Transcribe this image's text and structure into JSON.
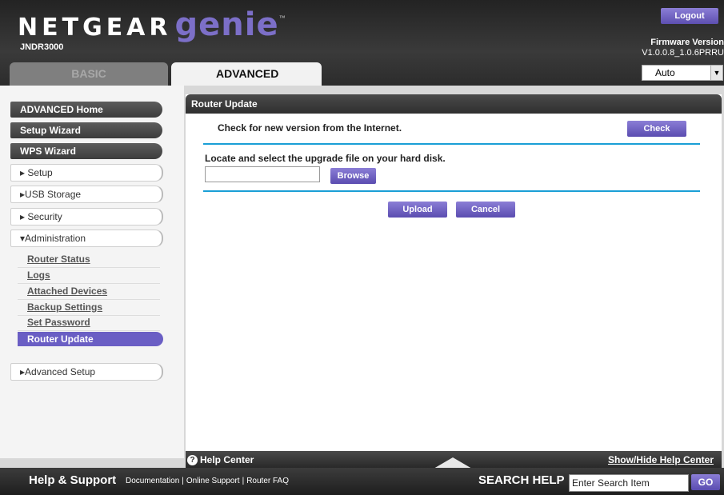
{
  "header": {
    "brand": "NETGEAR",
    "product": "genie",
    "trademark": "™",
    "model": "JNDR3000",
    "logout_label": "Logout",
    "firmware_label": "Firmware Version",
    "firmware_value": "V1.0.0.8_1.0.6PRRU",
    "tabs": {
      "basic": "BASIC",
      "advanced": "ADVANCED"
    },
    "selector_value": "Auto"
  },
  "sidebar": {
    "advanced_home": "ADVANCED Home",
    "setup_wizard": "Setup Wizard",
    "wps_wizard": "WPS Wizard",
    "setup": "▸ Setup",
    "usb_storage": "▸USB Storage",
    "security": "▸ Security",
    "administration": "▾Administration",
    "admin_items": [
      "Router Status",
      "Logs",
      "Attached Devices",
      "Backup Settings",
      "Set Password"
    ],
    "active_item": "Router Update",
    "advanced_setup": "▸Advanced Setup"
  },
  "main": {
    "title": "Router Update",
    "check_text": "Check for new version from the Internet.",
    "check_button": "Check",
    "locate_text": "Locate and select the upgrade file on your hard disk.",
    "browse_button": "Browse",
    "upload_button": "Upload",
    "cancel_button": "Cancel"
  },
  "helpbar": {
    "help_center": "Help Center",
    "toggle_label": "Show/Hide Help Center"
  },
  "footer": {
    "title": "Help & Support",
    "links": [
      "Documentation",
      "Online Support",
      "Router FAQ"
    ],
    "search_label": "SEARCH HELP",
    "search_value": "Enter Search Item",
    "go_label": "GO"
  },
  "colors": {
    "accent": "#6a5ec4",
    "divider": "#1a9fd6"
  }
}
